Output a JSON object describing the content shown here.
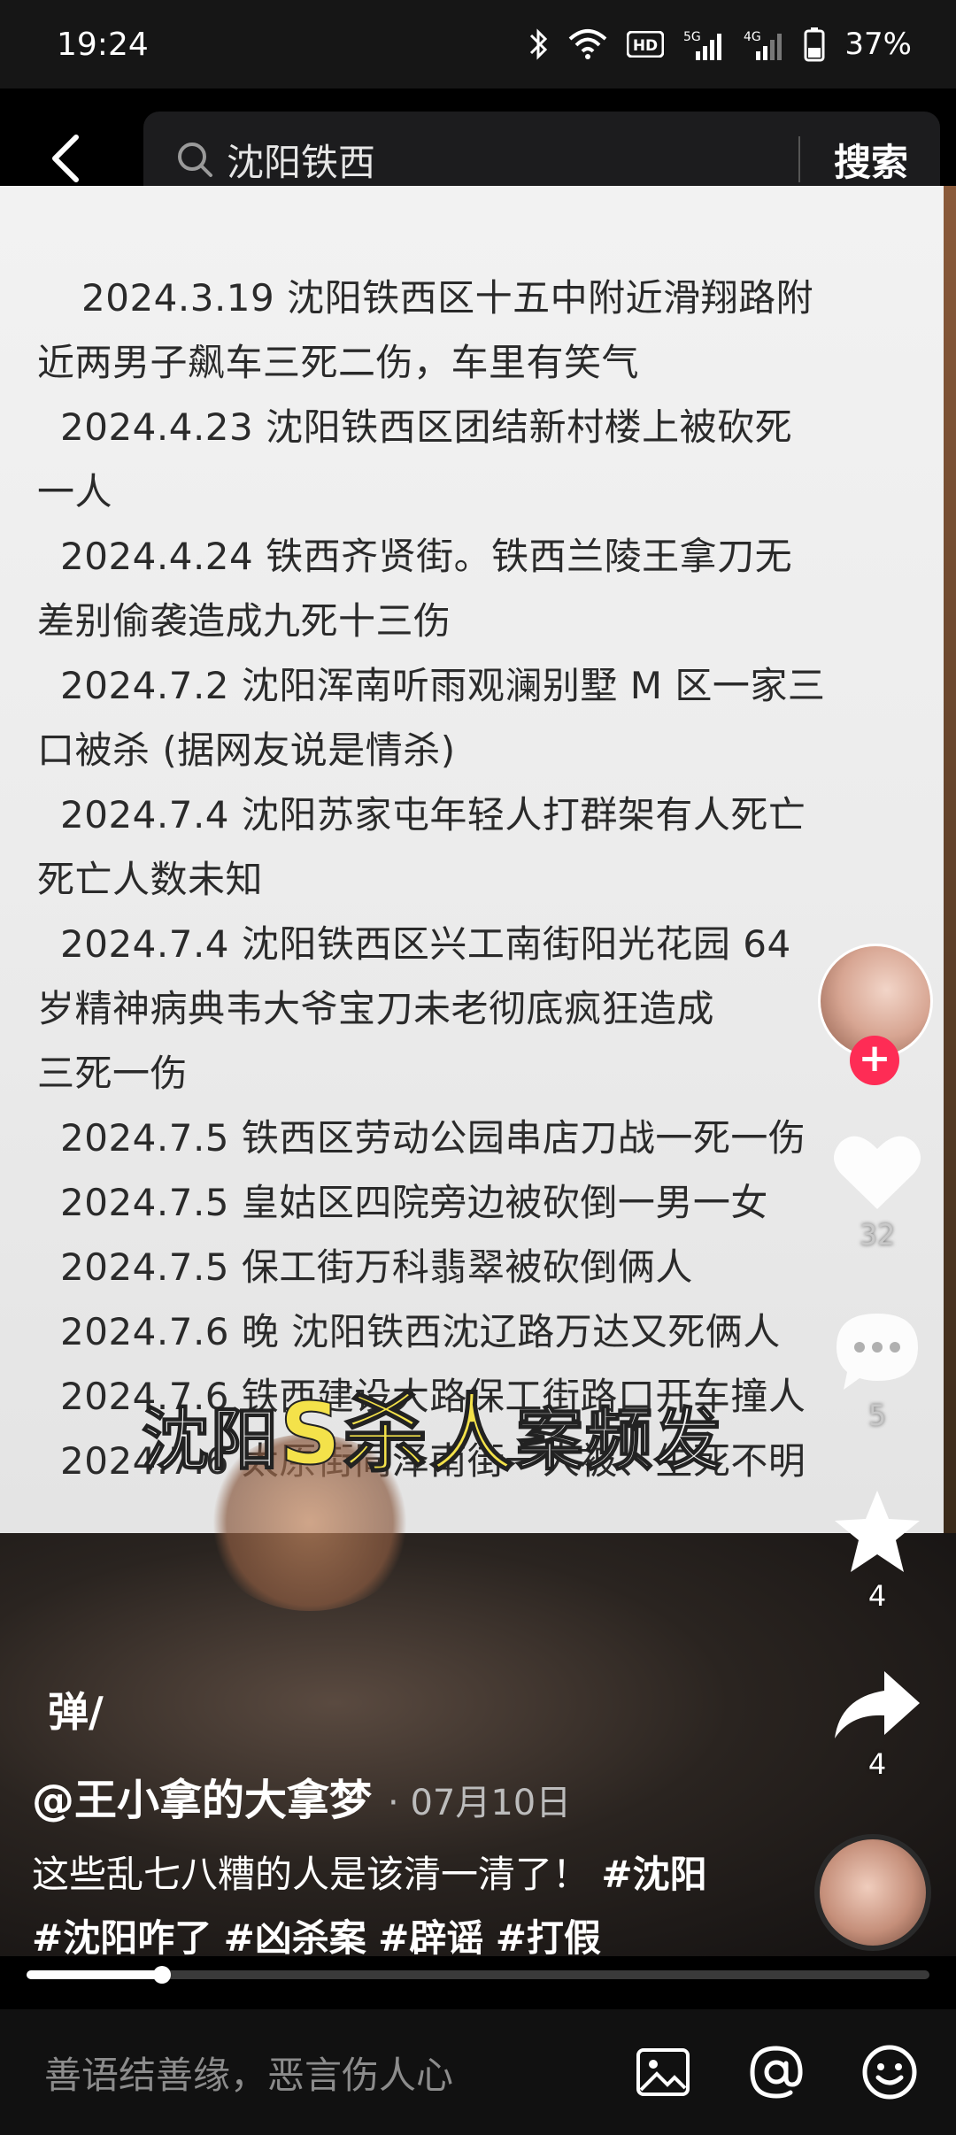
{
  "status_bar": {
    "time": "19:24",
    "battery": "37%",
    "icons": [
      "bluetooth-icon",
      "wifi-icon",
      "hd-icon",
      "signal-5g-icon",
      "signal-4g-icon",
      "battery-icon"
    ],
    "hd_label": "HD",
    "net1": "5G",
    "net2": "4G"
  },
  "search": {
    "query": "沈阳铁西",
    "button": "搜索"
  },
  "document": {
    "lines": [
      "2024.3.19 沈阳铁西区十五中附近滑翔路附",
      "近两男子飙车三死二伤，车里有笑气",
      "2024.4.23 沈阳铁西区团结新村楼上被砍死",
      "一人",
      "2024.4.24 铁西齐贤街。铁西兰陵王拿刀无",
      "差别偷袭造成九死十三伤",
      "2024.7.2 沈阳浑南听雨观澜别墅 M 区一家三",
      "口被杀 (据网友说是情杀)",
      "2024.7.4 沈阳苏家屯年轻人打群架有人死亡",
      "死亡人数未知",
      "2024.7.4 沈阳铁西区兴工南街阳光花园 64",
      "岁精神病典韦大爷宝刀未老彻底疯狂造成",
      "三死一伤",
      "2024.7.5 铁西区劳动公园串店刀战一死一伤",
      "2024.7.5 皇姑区四院旁边被砍倒一男一女",
      "2024.7.5 保工街万科翡翠被砍倒俩人",
      "2024.7.6 晚 沈阳铁西沈辽路万达又死俩人",
      "2024.7.6 铁西建设大路保工街路口开车撞人",
      "2024.7.6 太原街同泽南街一人被、生死不明"
    ],
    "line_styles": [
      "first",
      "plain",
      "indent",
      "plain",
      "indent",
      "plain",
      "indent",
      "plain",
      "indent",
      "plain",
      "indent",
      "plain",
      "plain",
      "indent",
      "indent",
      "indent",
      "indent",
      "indent",
      "indent"
    ]
  },
  "banner": {
    "part1": "沈阳",
    "part2": "S杀人",
    "part3": "案频发"
  },
  "actions": {
    "likes": "32",
    "comments": "5",
    "favorites": "4",
    "shares": "4"
  },
  "danmu_label": "弹",
  "post": {
    "author": "@王小拿的大拿梦",
    "date": "· 07月10日",
    "description": "这些乱七八糟的人是该清一清了！",
    "tags": [
      "#沈阳",
      "#沈阳咋了",
      "#凶杀案",
      "#辟谣",
      "#打假"
    ]
  },
  "progress": {
    "fraction": 0.15
  },
  "comment_bar": {
    "placeholder": "善语结善缘，恶言伤人心"
  }
}
